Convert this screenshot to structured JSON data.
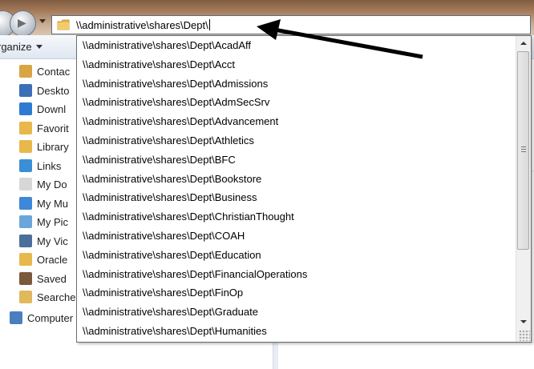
{
  "address_bar": {
    "path": "\\\\administrative\\shares\\Dept\\"
  },
  "toolbar": {
    "organize_label": "rganize"
  },
  "nav_pane": {
    "items": [
      {
        "label": "Contac",
        "icon": "contacts-icon"
      },
      {
        "label": "Deskto",
        "icon": "desktop-icon"
      },
      {
        "label": "Downl",
        "icon": "downloads-icon"
      },
      {
        "label": "Favorit",
        "icon": "favorites-icon"
      },
      {
        "label": "Library",
        "icon": "folder-icon"
      },
      {
        "label": "Links",
        "icon": "links-icon"
      },
      {
        "label": "My Do",
        "icon": "documents-icon"
      },
      {
        "label": "My Mu",
        "icon": "music-icon"
      },
      {
        "label": "My Pic",
        "icon": "pictures-icon"
      },
      {
        "label": "My Vic",
        "icon": "videos-icon"
      },
      {
        "label": "Oracle",
        "icon": "folder-icon"
      },
      {
        "label": "Saved",
        "icon": "saved-games-icon"
      },
      {
        "label": "Searches",
        "icon": "searches-icon"
      }
    ],
    "root_item": {
      "label": "Computer",
      "icon": "computer-icon"
    }
  },
  "suggestions": [
    "\\\\administrative\\shares\\Dept\\AcadAff",
    "\\\\administrative\\shares\\Dept\\Acct",
    "\\\\administrative\\shares\\Dept\\Admissions",
    "\\\\administrative\\shares\\Dept\\AdmSecSrv",
    "\\\\administrative\\shares\\Dept\\Advancement",
    "\\\\administrative\\shares\\Dept\\Athletics",
    "\\\\administrative\\shares\\Dept\\BFC",
    "\\\\administrative\\shares\\Dept\\Bookstore",
    "\\\\administrative\\shares\\Dept\\Business",
    "\\\\administrative\\shares\\Dept\\ChristianThought",
    "\\\\administrative\\shares\\Dept\\COAH",
    "\\\\administrative\\shares\\Dept\\Education",
    "\\\\administrative\\shares\\Dept\\FinancialOperations",
    "\\\\administrative\\shares\\Dept\\FinOp",
    "\\\\administrative\\shares\\Dept\\Graduate",
    "\\\\administrative\\shares\\Dept\\Humanities"
  ],
  "colors": {
    "folder": "#e8b84a",
    "annotation_arrow": "#000000",
    "address_border": "#5a6e85"
  }
}
